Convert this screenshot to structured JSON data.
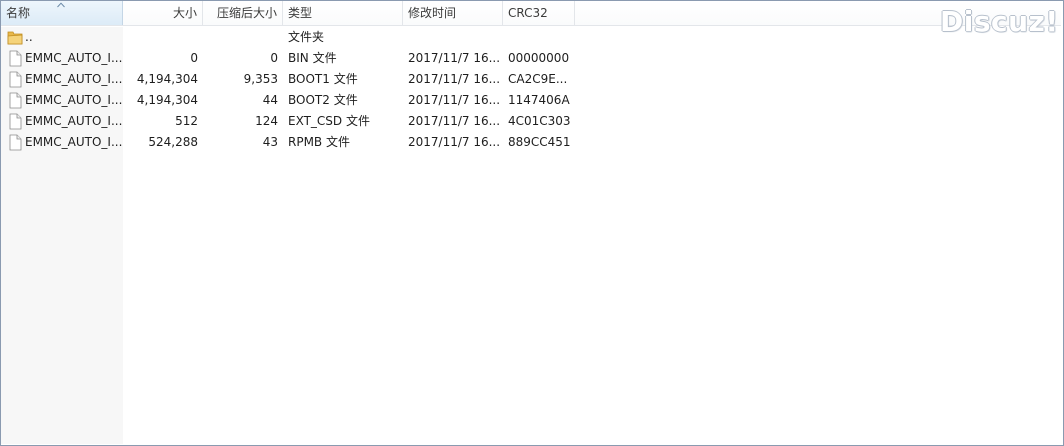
{
  "columns": {
    "name": "名称",
    "size": "大小",
    "packed": "压缩后大小",
    "type": "类型",
    "modified": "修改时间",
    "crc": "CRC32"
  },
  "rows": [
    {
      "name": "..",
      "size": "",
      "packed": "",
      "type": "文件夹",
      "modified": "",
      "crc": "",
      "icon": "folder-icon"
    },
    {
      "name": "EMMC_AUTO_I...",
      "size": "0",
      "packed": "0",
      "type": "BIN 文件",
      "modified": "2017/11/7 16...",
      "crc": "00000000",
      "icon": "file-icon"
    },
    {
      "name": "EMMC_AUTO_I...",
      "size": "4,194,304",
      "packed": "9,353",
      "type": "BOOT1 文件",
      "modified": "2017/11/7 16...",
      "crc": "CA2C9E...",
      "icon": "file-icon"
    },
    {
      "name": "EMMC_AUTO_I...",
      "size": "4,194,304",
      "packed": "44",
      "type": "BOOT2 文件",
      "modified": "2017/11/7 16...",
      "crc": "1147406A",
      "icon": "file-icon"
    },
    {
      "name": "EMMC_AUTO_I...",
      "size": "512",
      "packed": "124",
      "type": "EXT_CSD 文件",
      "modified": "2017/11/7 16...",
      "crc": "4C01C303",
      "icon": "file-icon"
    },
    {
      "name": "EMMC_AUTO_I...",
      "size": "524,288",
      "packed": "43",
      "type": "RPMB 文件",
      "modified": "2017/11/7 16...",
      "crc": "889CC451",
      "icon": "file-icon"
    }
  ],
  "watermark": "Discuz!"
}
